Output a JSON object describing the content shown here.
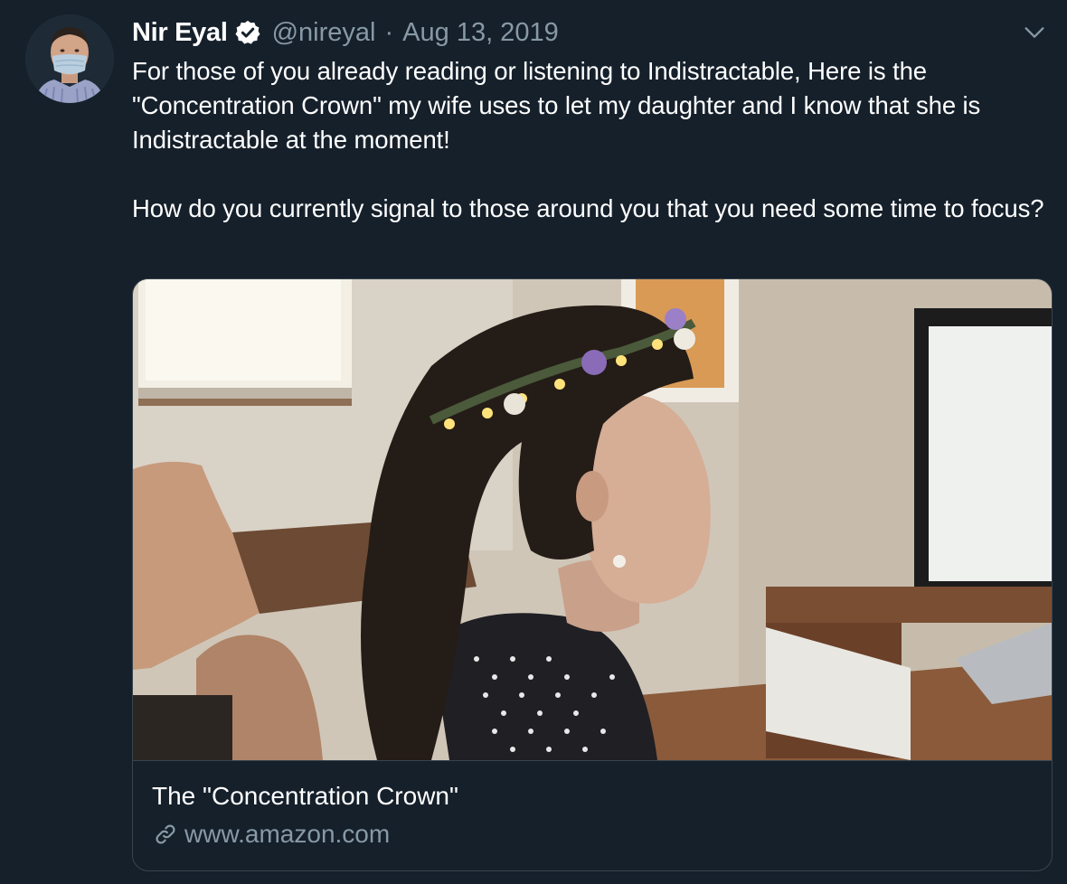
{
  "tweet": {
    "author_name": "Nir Eyal",
    "handle": "@nireyal",
    "separator": "·",
    "date": "Aug 13, 2019",
    "text_paragraphs": [
      "For those of you already reading or listening to Indistractable, Here is the \"Concentration Crown\" my wife uses to let my daughter and I know that she is Indistractable at the moment!",
      "How do you currently signal to those around you that you need some time to focus?"
    ]
  },
  "card": {
    "title": "The \"Concentration Crown\"",
    "domain": "www.amazon.com"
  },
  "icons": {
    "verified": "verified-badge-icon",
    "caret": "chevron-down-icon",
    "link": "link-icon"
  },
  "colors": {
    "background": "#15202b",
    "secondary_text": "#8899a6",
    "border": "#38444d",
    "primary_text": "#ffffff"
  }
}
